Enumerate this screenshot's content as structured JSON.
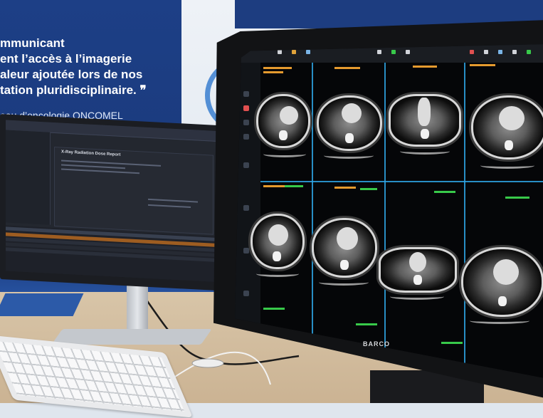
{
  "banner": {
    "lines": [
      "mmunicant",
      "ent l’accès à l’imagerie",
      "aleur ajoutée lors de nos",
      "tation pluridisciplinaire. ❞"
    ],
    "network_line": "eau d’oncologie ONCOMEL"
  },
  "left_monitor": {
    "report_title": "X-Ray Radiation Dose Report"
  },
  "right_monitor": {
    "brand": "BARCO",
    "viewer": {
      "layout": "4x2 axial CT chest grid",
      "overlay_colors": {
        "patient_info": "#e59a2e",
        "series_info": "#38c94a",
        "divider": "#2fa7e5"
      }
    }
  },
  "icons": [
    "toolbar-icon",
    "sidebar-tool-icon"
  ]
}
